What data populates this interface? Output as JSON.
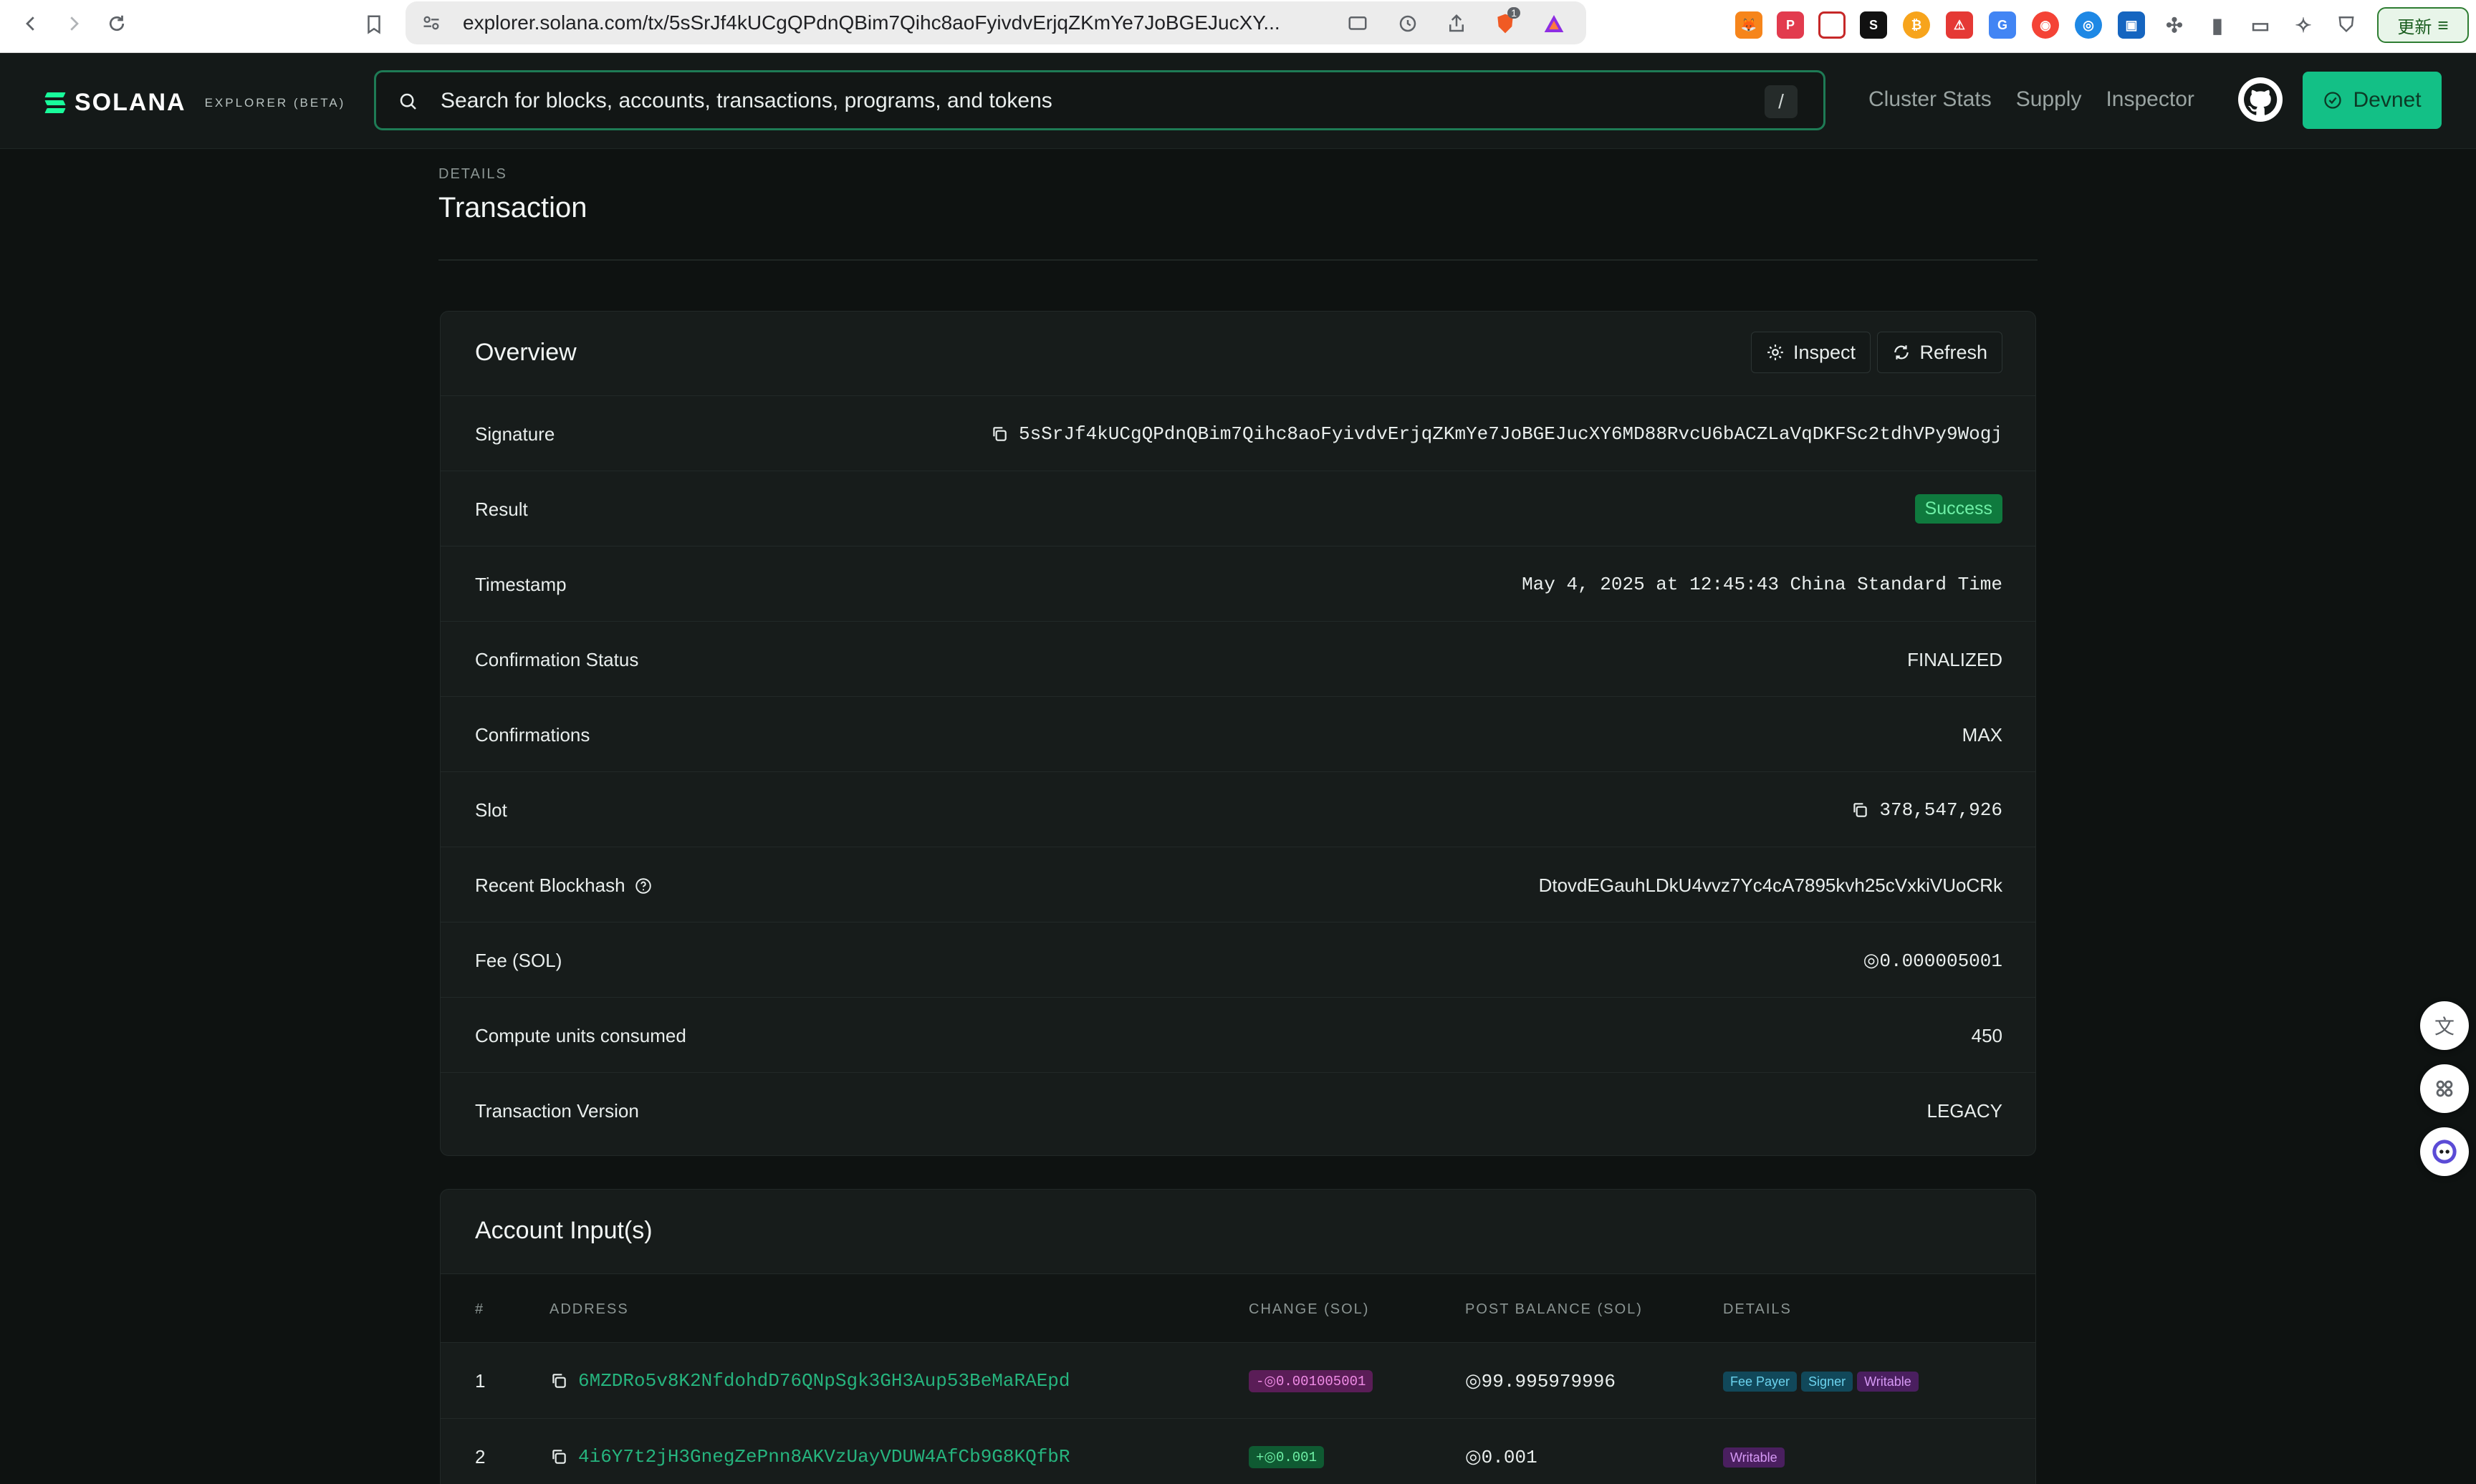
{
  "browser": {
    "url": "explorer.solana.com/tx/5sSrJf4kUCgQPdnQBim7Qihc8aoFyivdvErjqZKmYe7JoBGEJucXY...",
    "update_label": "更新",
    "brave_badge": "1"
  },
  "header": {
    "logo_word": "SOLANA",
    "logo_sub": "EXPLORER (BETA)",
    "search_placeholder": "Search for blocks, accounts, transactions, programs, and tokens",
    "search_shortcut": "/",
    "nav": [
      "Cluster Stats",
      "Supply",
      "Inspector"
    ],
    "cluster_label": "Devnet"
  },
  "page": {
    "eyebrow": "DETAILS",
    "title": "Transaction"
  },
  "overview": {
    "title": "Overview",
    "inspect_label": "Inspect",
    "refresh_label": "Refresh",
    "rows": {
      "signature": {
        "label": "Signature",
        "value": "5sSrJf4kUCgQPdnQBim7Qihc8aoFyivdvErjqZKmYe7JoBGEJucXY6MD88RvcU6bACZLaVqDKFSc2tdhVPy9Wogj"
      },
      "result": {
        "label": "Result",
        "value": "Success"
      },
      "timestamp": {
        "label": "Timestamp",
        "value": "May 4, 2025 at 12:45:43 China Standard Time"
      },
      "confirmation_status": {
        "label": "Confirmation Status",
        "value": "FINALIZED"
      },
      "confirmations": {
        "label": "Confirmations",
        "value": "MAX"
      },
      "slot": {
        "label": "Slot",
        "value": "378,547,926"
      },
      "recent_blockhash": {
        "label": "Recent Blockhash",
        "value": "DtovdEGauhLDkU4vvz7Yc4cA7895kvh25cVxkiVUoCRk"
      },
      "fee": {
        "label": "Fee (SOL)",
        "value": "◎0.000005001"
      },
      "compute_units": {
        "label": "Compute units consumed",
        "value": "450"
      },
      "version": {
        "label": "Transaction Version",
        "value": "LEGACY"
      }
    }
  },
  "accounts": {
    "title": "Account Input(s)",
    "columns": [
      "#",
      "ADDRESS",
      "CHANGE (SOL)",
      "POST BALANCE (SOL)",
      "DETAILS"
    ],
    "rows": [
      {
        "index": "1",
        "address": "6MZDRo5v8K2NfdohdD76QNpSgk3GH3Aup53BeMaRAEpd",
        "change": "-◎0.001005001",
        "post_balance": "◎99.995979996",
        "tags": [
          "Fee Payer",
          "Signer",
          "Writable"
        ]
      },
      {
        "index": "2",
        "address": "4i6Y7t2jH3GnegZePnn8AKVzUayVDUW4AfCb9G8KQfbR",
        "change": "+◎0.001",
        "post_balance": "◎0.001",
        "tags": [
          "Writable"
        ]
      }
    ]
  },
  "colors": {
    "accent": "#19fb9b",
    "link": "#26b47e",
    "devnet_bg": "#13c086",
    "search_border": "#1e7b55"
  }
}
